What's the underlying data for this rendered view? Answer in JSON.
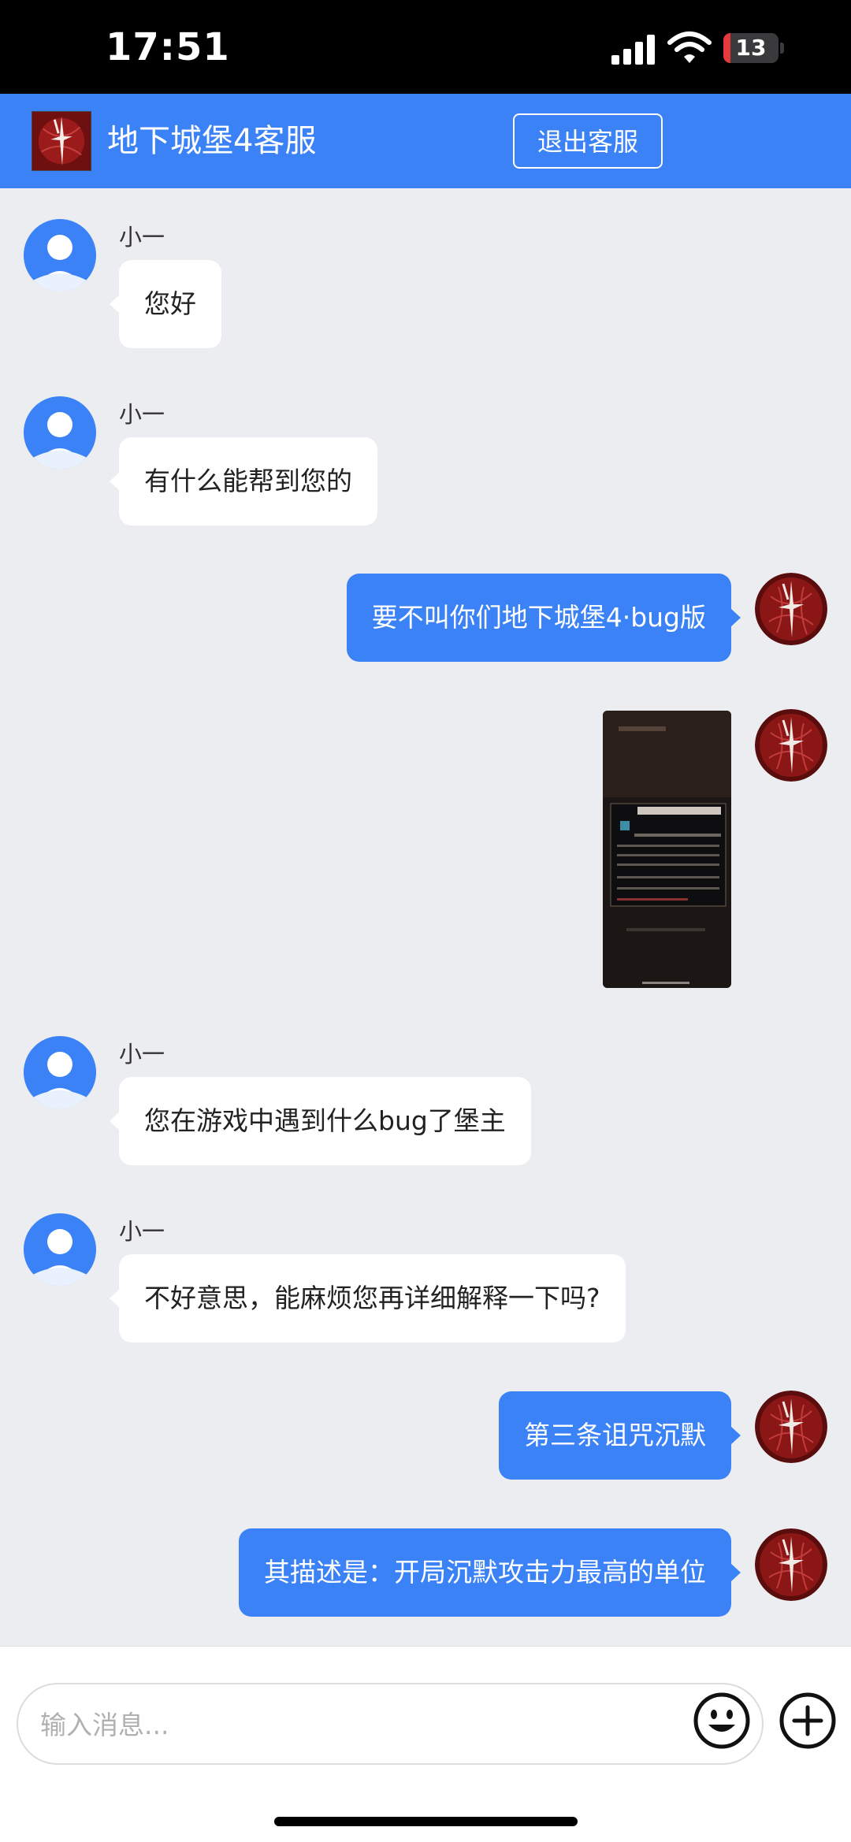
{
  "status_bar": {
    "time": "17:51",
    "battery": "13",
    "battery_level": 0.13
  },
  "header": {
    "title": "地下城堡4客服",
    "exit_label": "退出客服"
  },
  "messages": [
    {
      "side": "left",
      "sender": "小一",
      "text": "您好"
    },
    {
      "side": "left",
      "sender": "小一",
      "text": "有什么能帮到您的"
    },
    {
      "side": "right",
      "text": "要不叫你们地下城堡4·bug版"
    },
    {
      "side": "right",
      "type": "image"
    },
    {
      "side": "left",
      "sender": "小一",
      "text": "您在游戏中遇到什么bug了堡主"
    },
    {
      "side": "left",
      "sender": "小一",
      "text": "不好意思，能麻烦您再详细解释一下吗?"
    },
    {
      "side": "right",
      "text": "第三条诅咒沉默"
    },
    {
      "side": "right",
      "text": "其描述是：开局沉默攻击力最高的单位"
    }
  ],
  "input": {
    "placeholder": "输入消息..."
  },
  "colors": {
    "accent": "#3b82f6",
    "background": "#ecedf0",
    "bubble_left": "#ffffff"
  }
}
